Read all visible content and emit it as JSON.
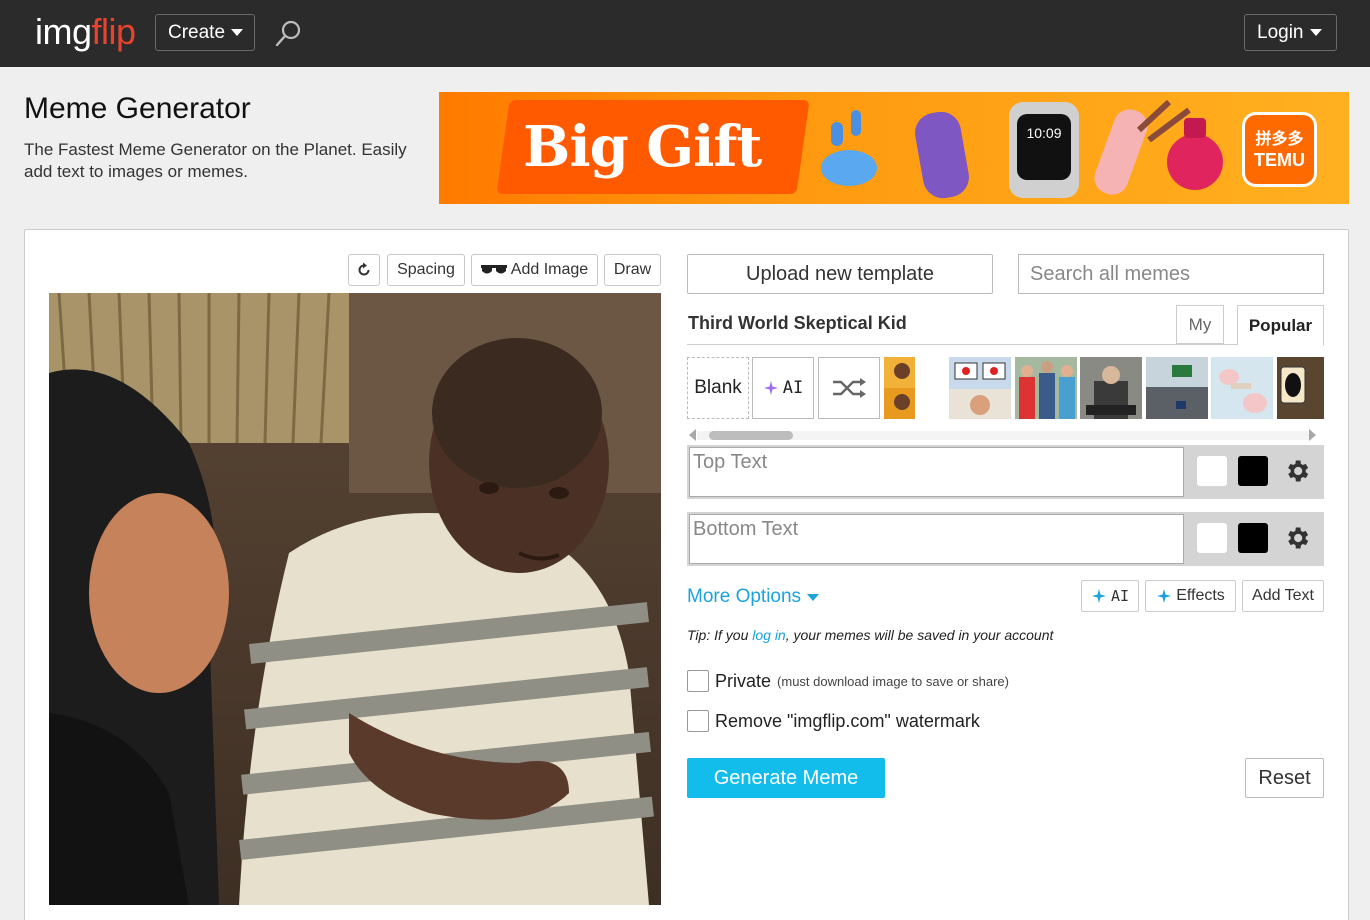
{
  "nav": {
    "logo_part1": "img",
    "logo_part2": "flip",
    "create_label": "Create",
    "login_label": "Login"
  },
  "header": {
    "title": "Meme Generator",
    "subtitle": "The Fastest Meme Generator on the Planet. Easily add text to images or memes."
  },
  "ad": {
    "headline": "Big Gift",
    "brand_line1": "拼多多",
    "brand_line2": "TEMU",
    "watch_time": "10:09"
  },
  "toolbar": {
    "spacing_label": "Spacing",
    "add_image_label": "Add Image",
    "draw_label": "Draw"
  },
  "templates": {
    "upload_label": "Upload new template",
    "search_placeholder": "Search all memes",
    "current_name": "Third World Skeptical Kid",
    "tab_my": "My",
    "tab_popular": "Popular",
    "blank_label": "Blank",
    "ai_label": "AI"
  },
  "text_boxes": [
    {
      "placeholder": "Top Text"
    },
    {
      "placeholder": "Bottom Text"
    }
  ],
  "options": {
    "more_options_label": "More Options",
    "ai_label": "AI",
    "effects_label": "Effects",
    "add_text_label": "Add Text",
    "tip_prefix": "Tip:",
    "tip_part1": " If you ",
    "tip_link": "log in",
    "tip_part2": ", your memes will be saved in your account",
    "private_label": "Private",
    "private_note": "(must download image to save or share)",
    "watermark_label": "Remove \"imgflip.com\" watermark",
    "generate_label": "Generate Meme",
    "reset_label": "Reset"
  },
  "colors": {
    "accent": "#12bdec",
    "link": "#1aa3dc",
    "nav_bg": "#2b2b2b",
    "logo_red": "#e8432e"
  }
}
